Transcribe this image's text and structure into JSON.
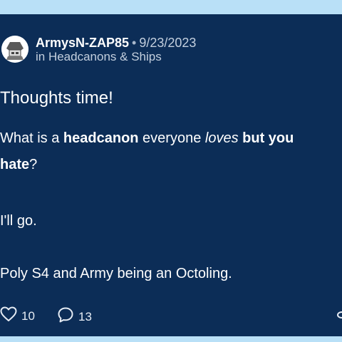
{
  "post": {
    "author": "ArmysN-ZAP85",
    "separator": "•",
    "date": "9/23/2023",
    "category": "in Headcanons & Ships",
    "title": "Thoughts time!",
    "body": {
      "line1": [
        {
          "text": "What is a ",
          "style": "normal"
        },
        {
          "text": "headcanon",
          "style": "bold"
        },
        {
          "text": " everyone ",
          "style": "normal"
        },
        {
          "text": "loves",
          "style": "italic"
        },
        {
          "text": " ",
          "style": "normal"
        },
        {
          "text": "but you",
          "style": "bold"
        }
      ],
      "line2": [
        {
          "text": "hate",
          "style": "bold"
        },
        {
          "text": "?",
          "style": "normal"
        }
      ],
      "line3": "I'll go.",
      "line4": "Poly S4 and Army being an Octoling."
    },
    "likes": "10",
    "replies": "13"
  },
  "icons": {
    "avatar": "user-avatar-icon",
    "like": "heart-icon",
    "reply": "speech-bubble-icon",
    "share": "link-icon"
  },
  "colors": {
    "background": "#b9e0f7",
    "card": "#0c2d57",
    "text": "#ffffff",
    "muted": "#c3cfde"
  }
}
